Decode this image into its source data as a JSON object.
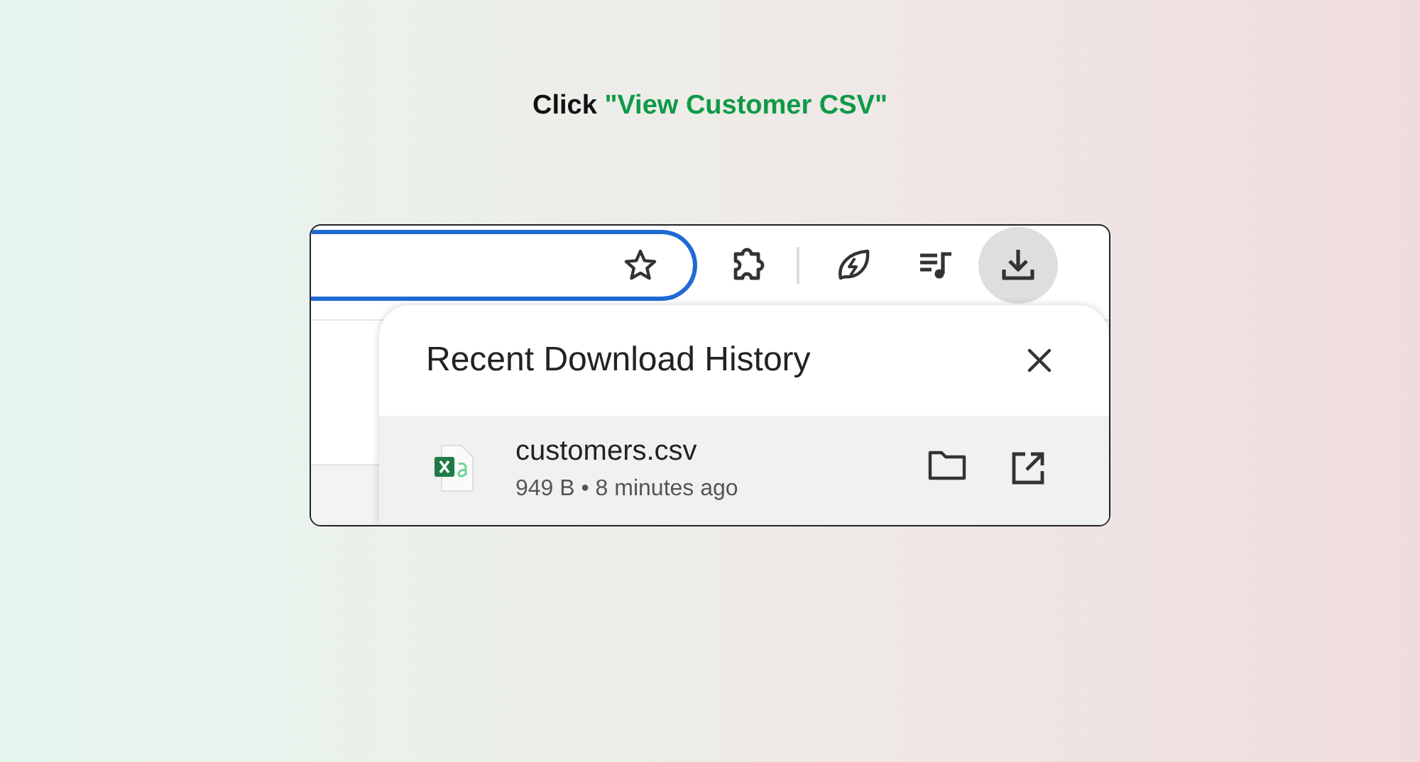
{
  "instruction": {
    "verb": "Click",
    "target": "\"View Customer CSV\""
  },
  "toolbar": {
    "bookmark_star": {
      "filled": false
    },
    "buttons": [
      {
        "kind": "extensions",
        "active": false
      },
      {
        "kind": "separator"
      },
      {
        "kind": "leaf",
        "active": false
      },
      {
        "kind": "media",
        "active": false
      },
      {
        "kind": "download",
        "active": true
      }
    ]
  },
  "downloads_panel": {
    "title": "Recent Download History",
    "items": [
      {
        "name": "customers.csv",
        "meta": "949 B • 8 minutes ago",
        "hovered": true
      }
    ]
  }
}
